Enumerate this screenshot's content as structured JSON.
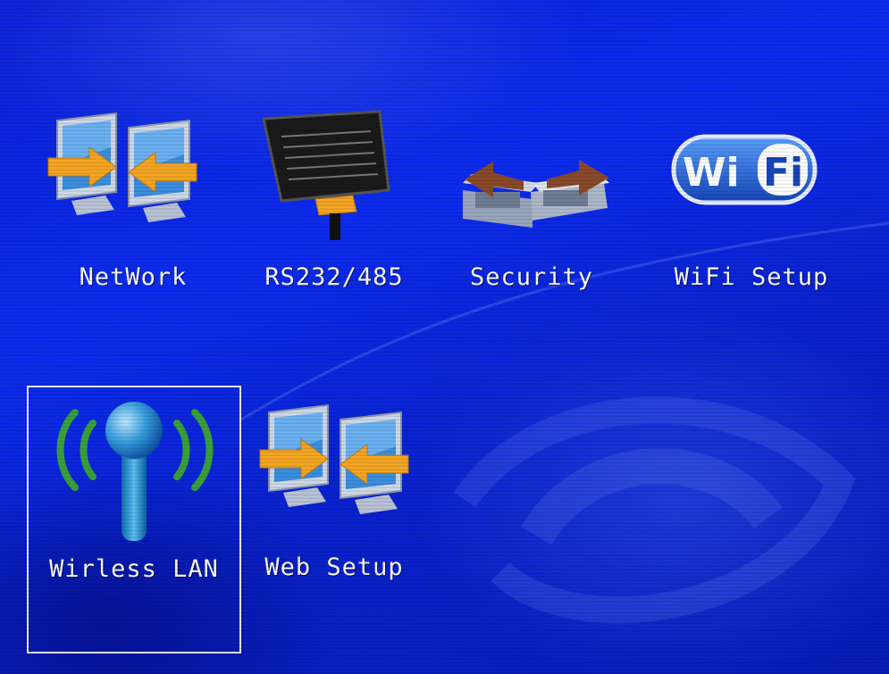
{
  "menu": {
    "items": [
      {
        "key": "network",
        "label": "NetWork",
        "icon": "network-monitors-icon"
      },
      {
        "key": "serial",
        "label": "RS232/485",
        "icon": "serial-connector-icon"
      },
      {
        "key": "security",
        "label": "Security",
        "icon": "security-connector-icon"
      },
      {
        "key": "wifi",
        "label": "WiFi  Setup",
        "icon": "wifi-logo-icon"
      },
      {
        "key": "wlan",
        "label": "Wirless LAN",
        "icon": "wireless-antenna-icon",
        "selected": true
      },
      {
        "key": "web",
        "label": "Web  Setup",
        "icon": "web-monitors-icon"
      }
    ],
    "wifi_logo_text": {
      "left": "Wi",
      "right": "Fi"
    }
  },
  "colors": {
    "background": "#0c2cf0",
    "label": "#ffffff",
    "selection_border": "#e8ecff",
    "arrow": "#f5a623",
    "antenna_wave": "#3aa13a"
  }
}
